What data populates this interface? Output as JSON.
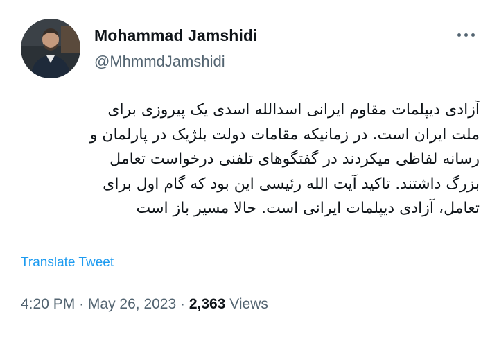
{
  "author": {
    "name": "Mohammad Jamshidi",
    "handle": "@MhmmdJamshidi"
  },
  "tweet": {
    "lines": [
      "آزادی دیپلمات مقاوم ایرانی اسدالله اسدی یک پیروزی برای",
      "ملت ایران است. در زمانیکه مقامات دولت بلژیک در پارلمان و",
      "رسانه لفاظی میکردند در گفتگوهای تلفنی درخواست تعامل",
      "بزرگ داشتند. تاکید آیت الله رئیسی این بود که گام اول برای",
      "تعامل، آزادی دیپلمات ایرانی است. حالا مسیر باز است"
    ],
    "translate_label": "Translate Tweet",
    "time": "4:20 PM",
    "separator": "·",
    "date": "May 26, 2023",
    "views_count": "2,363",
    "views_label": "Views"
  },
  "icons": {
    "more": "more-horizontal-icon",
    "avatar": "profile-photo"
  },
  "colors": {
    "link": "#1d9bf0",
    "secondary_text": "#536471",
    "primary_text": "#0f1419"
  }
}
